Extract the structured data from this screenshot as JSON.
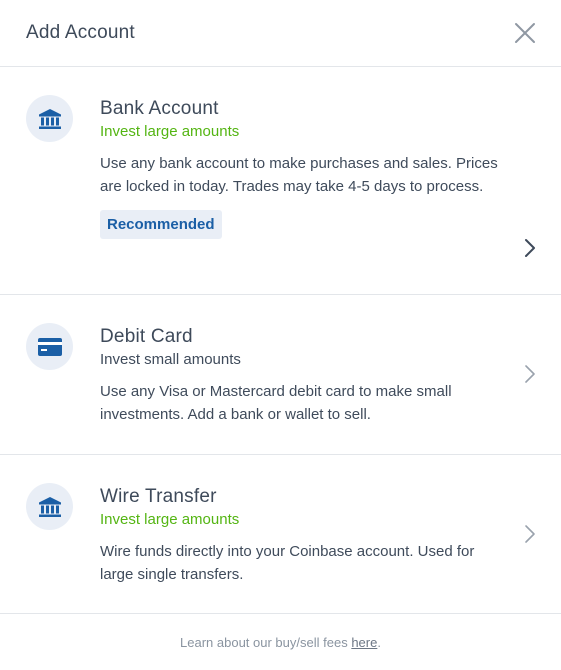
{
  "header": {
    "title": "Add Account",
    "close_icon": "close-icon"
  },
  "options": [
    {
      "icon": "bank-icon",
      "title": "Bank Account",
      "subtitle": "Invest large amounts",
      "subtitle_color": "#54b513",
      "description": "Use any bank account to make purchases and sales. Prices are locked in today. Trades may take 4-5 days to process.",
      "badge": "Recommended"
    },
    {
      "icon": "credit-card-icon",
      "title": "Debit Card",
      "subtitle": "Invest small amounts",
      "subtitle_color": "#3f4b5b",
      "description": "Use any Visa or Mastercard debit card to make small investments. Add a bank or wallet to sell."
    },
    {
      "icon": "bank-icon",
      "title": "Wire Transfer",
      "subtitle": "Invest large amounts",
      "subtitle_color": "#54b513",
      "description": "Wire funds directly into your Coinbase account. Used for large single transfers."
    }
  ],
  "footer": {
    "text_before": "Learn about our buy/sell fees ",
    "link": "here",
    "text_after": "."
  },
  "colors": {
    "accent_blue": "#1b5fa6",
    "icon_bg": "#e9eef6",
    "green": "#54b513"
  }
}
